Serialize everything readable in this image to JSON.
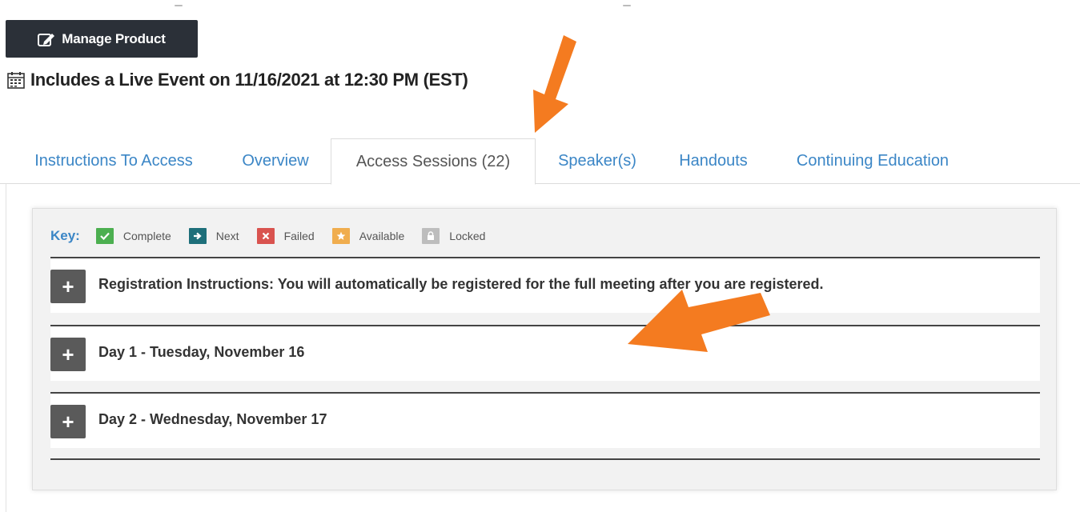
{
  "toolbar": {
    "manage_label": "Manage Product",
    "manage_icon": "edit-icon"
  },
  "event": {
    "icon": "calendar-icon",
    "text": "Includes a Live Event on 11/16/2021 at 12:30 PM (EST)"
  },
  "tabs": [
    {
      "label": "Instructions To Access",
      "active": false
    },
    {
      "label": "Overview",
      "active": false
    },
    {
      "label": "Access Sessions (22)",
      "active": true
    },
    {
      "label": "Speaker(s)",
      "active": false
    },
    {
      "label": "Handouts",
      "active": false
    },
    {
      "label": "Continuing Education",
      "active": false
    }
  ],
  "key": {
    "label": "Key:",
    "items": [
      {
        "label": "Complete",
        "icon": "check-icon",
        "color": "#4caf50"
      },
      {
        "label": "Next",
        "icon": "arrow-right-icon",
        "color": "#1e6f7a"
      },
      {
        "label": "Failed",
        "icon": "x-icon",
        "color": "#d9534f"
      },
      {
        "label": "Available",
        "icon": "star-icon",
        "color": "#f0ad4e"
      },
      {
        "label": "Locked",
        "icon": "lock-icon",
        "color": "#bdbdbd"
      }
    ]
  },
  "sessions": [
    {
      "label": "Registration Instructions: You will automatically be registered for the full meeting after you are registered."
    },
    {
      "label": "Day 1 - Tuesday, November 16"
    },
    {
      "label": "Day 2 - Wednesday, November 17"
    }
  ],
  "colors": {
    "accent_link": "#3b86c6",
    "button_dark": "#2b3038",
    "annotation_arrow": "#f47b20"
  }
}
